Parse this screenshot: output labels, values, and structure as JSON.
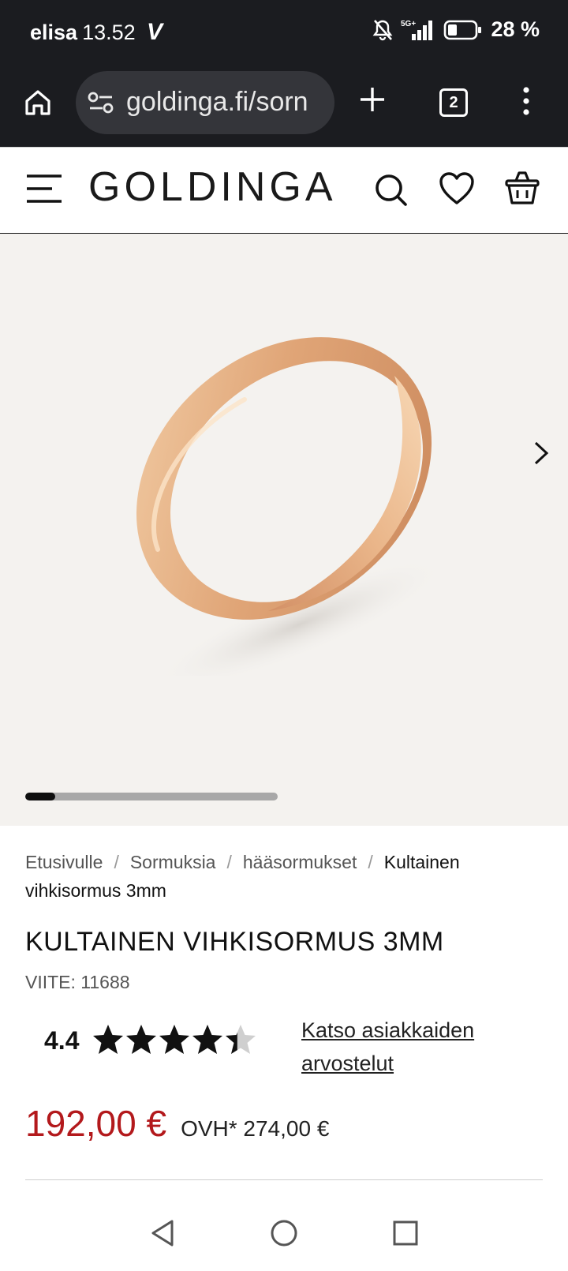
{
  "status": {
    "carrier": "elisa",
    "time": "13.52",
    "network": "5G+",
    "battery": "28 %"
  },
  "browser": {
    "url": "goldinga.fi/sorn",
    "tab_count": "2"
  },
  "site": {
    "logo": "GOLDINGA"
  },
  "gallery": {
    "progress_fraction": 0.12
  },
  "breadcrumb": {
    "items": [
      "Etusivulle",
      "Sormuksia",
      "hääsormukset"
    ],
    "current": "Kultainen vihkisormus 3mm",
    "separator": "/"
  },
  "product": {
    "title": "KULTAINEN VIHKISORMUS 3MM",
    "ref": "VIITE: 11688",
    "rating": "4.4",
    "rating_value": 4.4,
    "reviews_link": "Katso asiakkaiden arvostelut",
    "price": "192,00 €",
    "old_price": "OVH* 274,00 €"
  },
  "colors": {
    "accent_price": "#b3191c",
    "browser_bar": "#1b1c20",
    "gallery_bg": "#f4f2ef"
  }
}
